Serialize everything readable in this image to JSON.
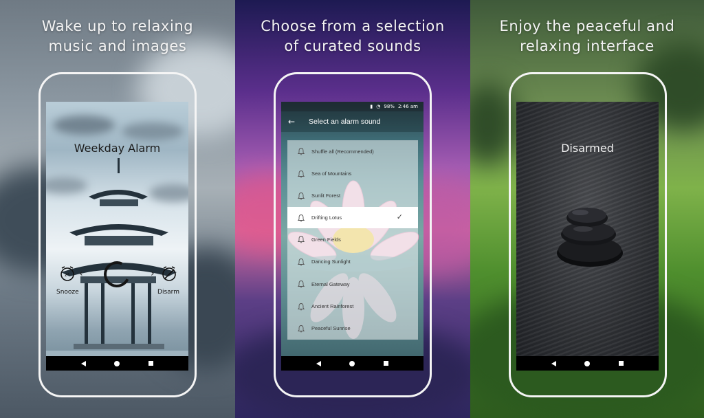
{
  "panels": {
    "left": {
      "caption_line1": "Wake up to relaxing",
      "caption_line2": "music and images",
      "screen": {
        "alarm_title": "Weekday Alarm",
        "snooze_label": "Snooze",
        "disarm_label": "Disarm",
        "left_chevron": "‹",
        "right_chevron": "›"
      }
    },
    "middle": {
      "caption_line1": "Choose from a selection",
      "caption_line2": "of curated sounds",
      "screen": {
        "status": {
          "battery": "98%",
          "time": "2:46 am"
        },
        "title": "Select an alarm sound",
        "sounds": [
          {
            "label": "Shuffle all (Recommended)",
            "selected": false
          },
          {
            "label": "Sea of Mountains",
            "selected": false
          },
          {
            "label": "Sunlit Forest",
            "selected": false
          },
          {
            "label": "Drifting Lotus",
            "selected": true
          },
          {
            "label": "Green Fields",
            "selected": false
          },
          {
            "label": "Dancing Sunlight",
            "selected": false
          },
          {
            "label": "Eternal Gateway",
            "selected": false
          },
          {
            "label": "Ancient Rainforest",
            "selected": false
          },
          {
            "label": "Peaceful Sunrise",
            "selected": false
          }
        ]
      }
    },
    "right": {
      "caption_line1": "Enjoy the peaceful and",
      "caption_line2": "relaxing interface",
      "screen": {
        "status_text": "Disarmed"
      }
    }
  },
  "icons": {
    "nav": [
      "back-icon",
      "home-icon",
      "recent-apps-icon"
    ],
    "snooze": "snooze-alarm-clock-icon",
    "disarm": "disarm-alarm-clock-icon",
    "sound": "bell-icon",
    "selected": "checkmark-icon"
  }
}
